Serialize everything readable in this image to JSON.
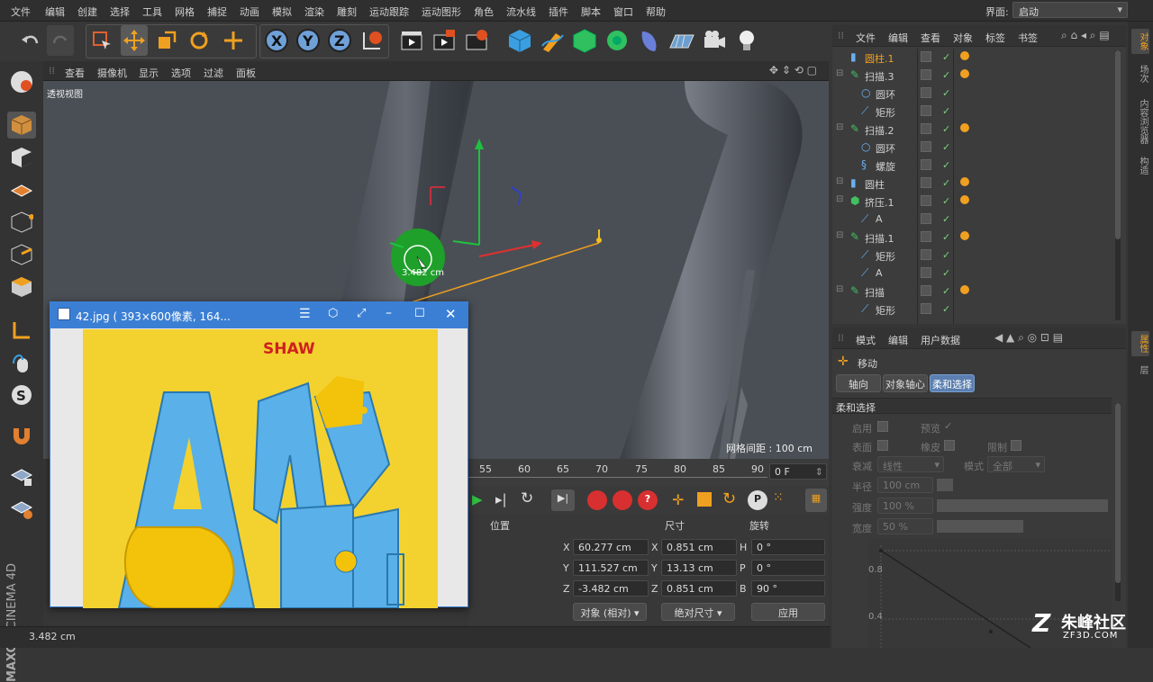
{
  "menubar": {
    "items": [
      "文件",
      "编辑",
      "创建",
      "选择",
      "工具",
      "网格",
      "捕捉",
      "动画",
      "模拟",
      "渲染",
      "雕刻",
      "运动跟踪",
      "运动图形",
      "角色",
      "流水线",
      "插件",
      "脚本",
      "窗口",
      "帮助"
    ],
    "layout_label": "界面:",
    "layout_value": "启动"
  },
  "viewport": {
    "menu": [
      "查看",
      "摄像机",
      "显示",
      "选项",
      "过滤",
      "面板"
    ],
    "view_name": "透视视图",
    "grid_spacing": "网格间距 : 100 cm",
    "measure": "3.482 cm"
  },
  "timeline": {
    "ticks": [
      "55",
      "60",
      "65",
      "70",
      "75",
      "80",
      "85",
      "90"
    ],
    "frame": "0 F"
  },
  "coords": {
    "headers": [
      "位置",
      "尺寸",
      "旋转"
    ],
    "rows": [
      {
        "axis": "X",
        "pos": "60.277 cm",
        "size_axis": "X",
        "size": "0.851 cm",
        "rot_axis": "H",
        "rot": "0 °"
      },
      {
        "axis": "Y",
        "pos": "111.527 cm",
        "size_axis": "Y",
        "size": "13.13 cm",
        "rot_axis": "P",
        "rot": "0 °"
      },
      {
        "axis": "Z",
        "pos": "-3.482 cm",
        "size_axis": "Z",
        "size": "0.851 cm",
        "rot_axis": "B",
        "rot": "90 °"
      }
    ],
    "mode": "对象 (相对)",
    "size_mode": "绝对尺寸",
    "apply": "应用"
  },
  "status": {
    "text": "3.482 cm"
  },
  "objmgr": {
    "menu": [
      "文件",
      "编辑",
      "查看",
      "对象",
      "标签",
      "书签"
    ],
    "items": [
      {
        "name": "圆柱.1",
        "icon": "cylinder-icon",
        "indent": 0,
        "selected": true
      },
      {
        "name": "扫描.3",
        "icon": "sweep-icon",
        "indent": 0
      },
      {
        "name": "圆环",
        "icon": "circle-icon",
        "indent": 1
      },
      {
        "name": "矩形",
        "icon": "rectangle-spline-icon",
        "indent": 1
      },
      {
        "name": "扫描.2",
        "icon": "sweep-icon",
        "indent": 0
      },
      {
        "name": "圆环",
        "icon": "circle-icon",
        "indent": 1
      },
      {
        "name": "螺旋",
        "icon": "helix-icon",
        "indent": 1
      },
      {
        "name": "圆柱",
        "icon": "cylinder-icon",
        "indent": 0
      },
      {
        "name": "挤压.1",
        "icon": "extrude-icon",
        "indent": 0
      },
      {
        "name": "A",
        "icon": "spline-icon",
        "indent": 1
      },
      {
        "name": "扫描.1",
        "icon": "sweep-icon",
        "indent": 0
      },
      {
        "name": "矩形",
        "icon": "rectangle-spline-icon",
        "indent": 1
      },
      {
        "name": "A",
        "icon": "spline-icon",
        "indent": 1
      },
      {
        "name": "扫描",
        "icon": "sweep-icon",
        "indent": 0
      },
      {
        "name": "矩形",
        "icon": "rectangle-spline-icon",
        "indent": 1
      }
    ]
  },
  "attrmgr": {
    "menu": [
      "模式",
      "编辑",
      "用户数据"
    ],
    "tool": "移动",
    "tabs": [
      "轴向",
      "对象轴心",
      "柔和选择"
    ],
    "section": "柔和选择",
    "labels": {
      "enable": "启用",
      "preview": "预览",
      "surface": "表面",
      "rubber": "橡皮",
      "limit": "限制",
      "falloff": "衰减",
      "falloff_val": "线性",
      "mode": "模式",
      "mode_val": "全部",
      "radius": "半径",
      "radius_val": "100 cm",
      "strength": "强度",
      "strength_val": "100 %",
      "width": "宽度",
      "width_val": "50 %",
      "g1": "0.8",
      "g2": "0.4"
    }
  },
  "righttabs": [
    "对象",
    "场次",
    "内容浏览器",
    "构造",
    "属性",
    "层"
  ],
  "imgviewer": {
    "title": "42.jpg ( 393×600像素, 164...",
    "poster_title": "SHAW"
  },
  "brand": {
    "maxon": "MAXON",
    "c4d": "CINEMA 4D",
    "watermark": "朱峰社区",
    "watermark_url": "ZF3D.COM"
  },
  "colors": {
    "accent": "#f0a020",
    "selection_blue": "#3b7fd4",
    "green_check": "#7fcf7f"
  }
}
